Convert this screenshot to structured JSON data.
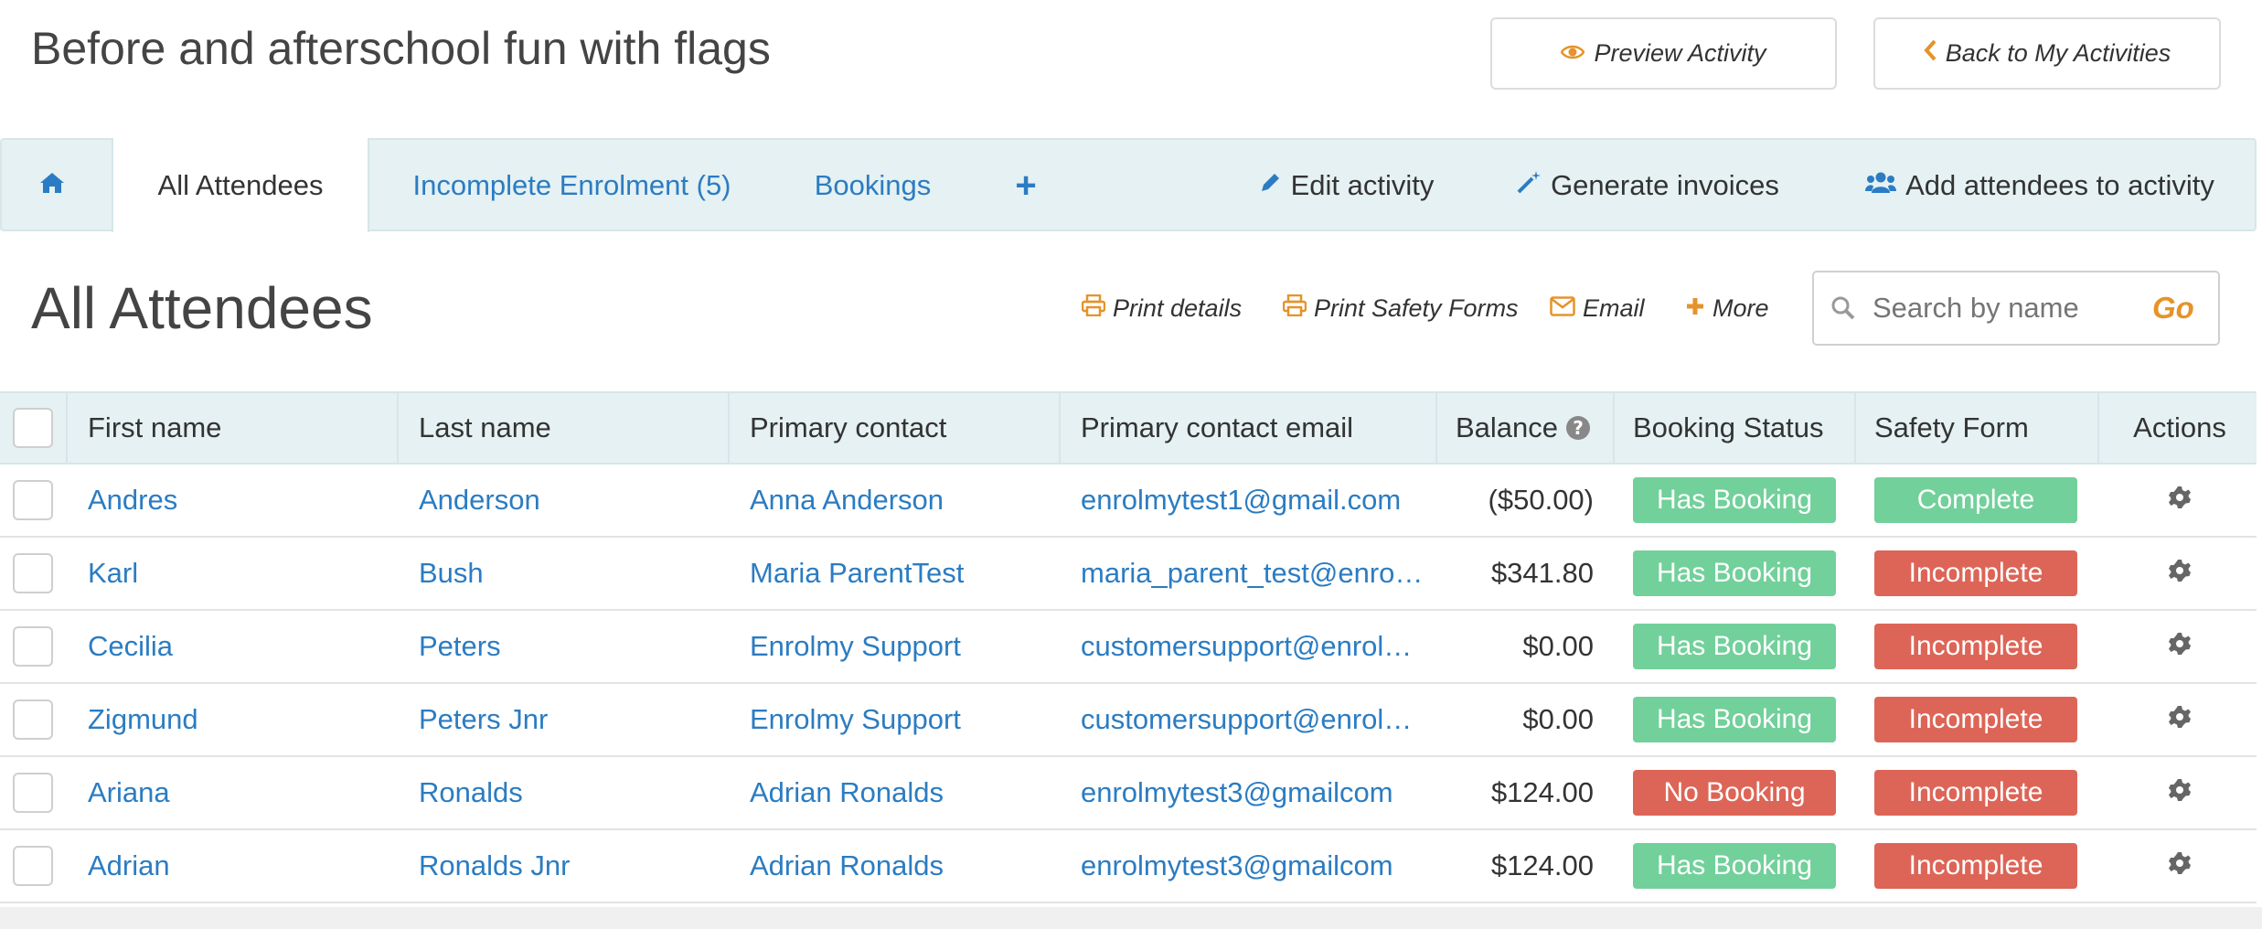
{
  "header": {
    "title": "Before and afterschool fun with flags",
    "preview_label": "Preview Activity",
    "back_label": "Back to My Activities"
  },
  "tabs": {
    "all_attendees": "All Attendees",
    "incomplete": "Incomplete Enrolment (5)",
    "bookings": "Bookings",
    "plus": "+",
    "edit": "Edit activity",
    "generate": "Generate invoices",
    "add_attendees": "Add attendees to activity"
  },
  "section": {
    "title": "All Attendees",
    "print_details": "Print details",
    "print_safety": "Print Safety Forms",
    "email": "Email",
    "more": "More",
    "search_placeholder": "Search by name",
    "go": "Go"
  },
  "table": {
    "headers": {
      "first": "First name",
      "last": "Last name",
      "primary_contact": "Primary contact",
      "primary_email": "Primary contact email",
      "balance": "Balance",
      "booking_status": "Booking Status",
      "safety_form": "Safety Form",
      "actions": "Actions"
    },
    "rows": [
      {
        "first": "Andres",
        "last": "Anderson",
        "contact": "Anna Anderson",
        "email": "enrolmytest1@gmail.com",
        "balance": "($50.00)",
        "booking": "Has Booking",
        "safety": "Complete"
      },
      {
        "first": "Karl",
        "last": "Bush",
        "contact": "Maria ParentTest",
        "email": "maria_parent_test@enrolmy.com",
        "balance": "$341.80",
        "booking": "Has Booking",
        "safety": "Incomplete"
      },
      {
        "first": "Cecilia",
        "last": "Peters",
        "contact": "Enrolmy Support",
        "email": "customersupport@enrolmy.com",
        "balance": "$0.00",
        "booking": "Has Booking",
        "safety": "Incomplete"
      },
      {
        "first": "Zigmund",
        "last": "Peters Jnr",
        "contact": "Enrolmy Support",
        "email": "customersupport@enrolmy.com",
        "balance": "$0.00",
        "booking": "Has Booking",
        "safety": "Incomplete"
      },
      {
        "first": "Ariana",
        "last": "Ronalds",
        "contact": "Adrian Ronalds",
        "email": "enrolmytest3@gmailcom",
        "balance": "$124.00",
        "booking": "No Booking",
        "safety": "Incomplete"
      },
      {
        "first": "Adrian",
        "last": "Ronalds Jnr",
        "contact": "Adrian Ronalds",
        "email": "enrolmytest3@gmailcom",
        "balance": "$124.00",
        "booking": "Has Booking",
        "safety": "Incomplete"
      }
    ]
  },
  "colors": {
    "link": "#2b7cc2",
    "accent_orange": "#e5932a",
    "status_green": "#72d09b",
    "status_red": "#dd6557",
    "tabbar_bg": "#e5f1f2"
  }
}
